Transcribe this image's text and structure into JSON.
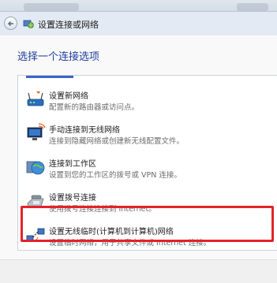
{
  "window": {
    "title": "设置连接或网络"
  },
  "main": {
    "heading": "选择一个连接选项"
  },
  "options": [
    {
      "title": "设置新网络",
      "description": "配置新的路由器或访问点。",
      "icon": "router-icon"
    },
    {
      "title": "手动连接到无线网络",
      "description": "连接到隐藏网络或创建新无线配置文件。",
      "icon": "wireless-monitor-icon"
    },
    {
      "title": "连接到工作区",
      "description": "设置到您的工作区的拨号或 VPN 连接。",
      "icon": "workplace-globe-icon"
    },
    {
      "title": "设置拨号连接",
      "description": "使用拨号连接连接到 Internet。",
      "icon": "dialup-phone-icon"
    },
    {
      "title": "设置无线临时(计算机到计算机)网络",
      "description": "设置临时网络，用于共享文件或 Internet 连接。",
      "icon": "adhoc-network-icon"
    }
  ],
  "colors": {
    "heading": "#1f3e9e",
    "highlight_border": "#e2232a",
    "selection_edge": "#3f62c4"
  }
}
